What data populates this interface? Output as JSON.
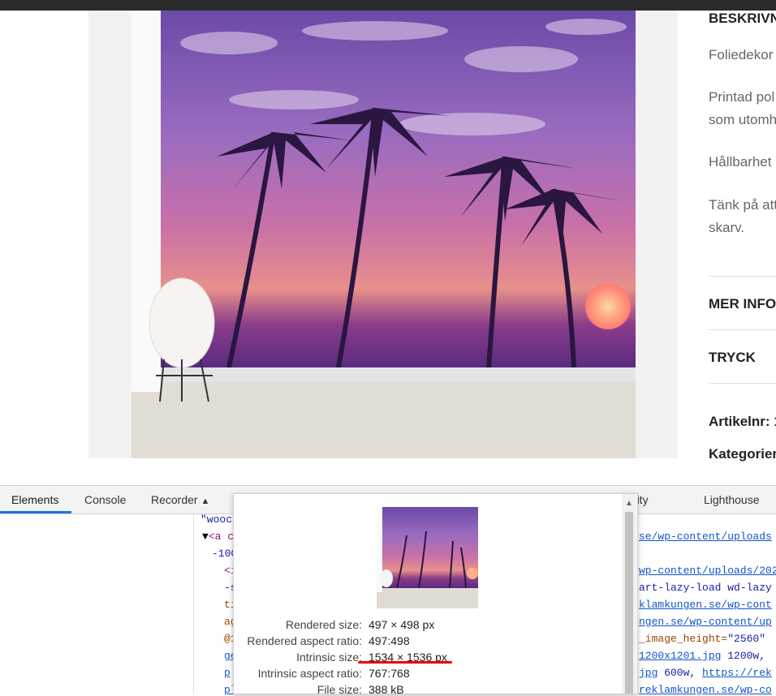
{
  "sidebar": {
    "heading_description": "BESKRIVNING",
    "p1": "Foliedekor",
    "p2a": "Printad pol",
    "p2b": "som utomh",
    "p3": "Hållbarhet",
    "p4a": "Tänk på att",
    "p4b": "skarv.",
    "heading_more": "MER INFO",
    "heading_print": "TRYCK",
    "article_label": "Artikelnr: 1",
    "category_label": "Kategorier"
  },
  "devtools": {
    "tabs": [
      "Elements",
      "Console",
      "Recorder",
      "Security",
      "Lighthouse"
    ],
    "recorder_icon": "flask-icon",
    "code_lines": {
      "l1": "\"wooc",
      "l2a": "<a c",
      "l2b": "-100",
      "l3": "<i",
      "l4": "-s",
      "l5": "ti",
      "l6": "ag",
      "l7": "@1",
      "l8": "ge",
      "l9": "p",
      "l10": "pl"
    },
    "right_lines": {
      "r1": "se/wp-content/uploads",
      "r2": "wp-content/uploads/202",
      "r3": "art-lazy-load wd-lazy",
      "r4": "klamkungen.se/wp-cont",
      "r5": "ngen.se/wp-content/up",
      "r6a": "_image_height=",
      "r6b": "\"2560\"",
      "r7a": "1200x1201.jpg",
      "r7b": " 1200w,",
      "r8a": "jpg",
      "r8b": " 600w, ",
      "r8c": "https://rek",
      "r9": "reklamkungen.se/wp-co"
    }
  },
  "image_info": {
    "rendered_size_label": "Rendered size:",
    "rendered_size": "497 × 498 px",
    "rendered_ratio_label": "Rendered aspect ratio:",
    "rendered_ratio": "497:498",
    "intrinsic_size_label": "Intrinsic size:",
    "intrinsic_size": "1534 × 1536 px",
    "intrinsic_ratio_label": "Intrinsic aspect ratio:",
    "intrinsic_ratio": "767:768",
    "file_size_label": "File size:",
    "file_size": "388 kB"
  }
}
